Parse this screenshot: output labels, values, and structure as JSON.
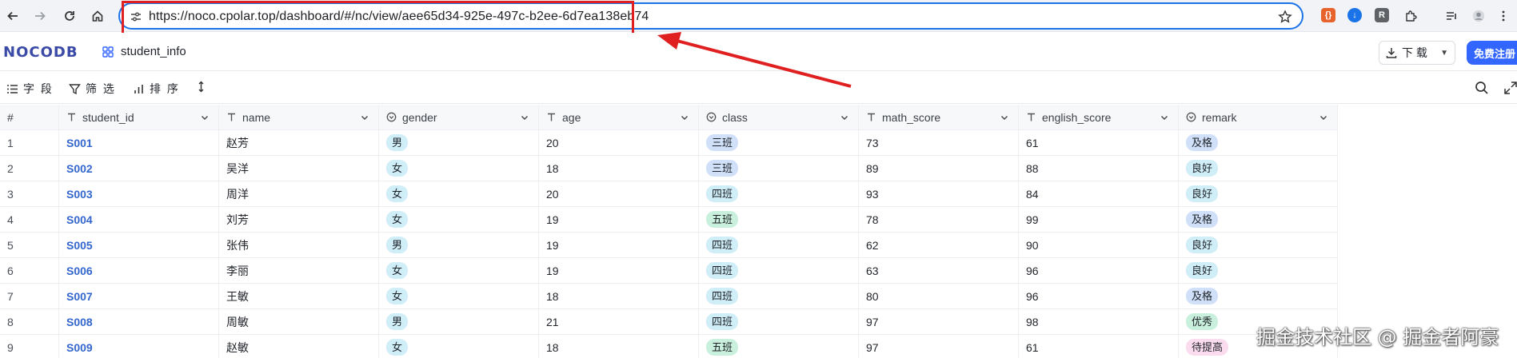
{
  "browser": {
    "url": "https://noco.cpolar.top/dashboard/#/nc/view/aee65d34-925e-497c-b2ee-6d7ea138eb74"
  },
  "app": {
    "logo": "NOCODB",
    "table_title": "student_info",
    "download_label": "下 载",
    "signup_label": "免费注册"
  },
  "toolbar": {
    "fields_label": "字 段",
    "filter_label": "筛 选",
    "sort_label": "排 序"
  },
  "grid": {
    "columns": [
      {
        "label": "#",
        "icon": "none"
      },
      {
        "label": "student_id",
        "icon": "text-icon"
      },
      {
        "label": "name",
        "icon": "text-icon"
      },
      {
        "label": "gender",
        "icon": "select-icon"
      },
      {
        "label": "age",
        "icon": "text-icon"
      },
      {
        "label": "class",
        "icon": "select-icon"
      },
      {
        "label": "math_score",
        "icon": "text-icon"
      },
      {
        "label": "english_score",
        "icon": "text-icon"
      },
      {
        "label": "remark",
        "icon": "select-icon"
      }
    ],
    "rows": [
      {
        "n": "1",
        "student_id": "S001",
        "name": "赵芳",
        "gender": "男",
        "age": "20",
        "class": "三班",
        "math_score": "73",
        "english_score": "61",
        "remark": "及格"
      },
      {
        "n": "2",
        "student_id": "S002",
        "name": "吴洋",
        "gender": "女",
        "age": "18",
        "class": "三班",
        "math_score": "89",
        "english_score": "88",
        "remark": "良好"
      },
      {
        "n": "3",
        "student_id": "S003",
        "name": "周洋",
        "gender": "女",
        "age": "20",
        "class": "四班",
        "math_score": "93",
        "english_score": "84",
        "remark": "良好"
      },
      {
        "n": "4",
        "student_id": "S004",
        "name": "刘芳",
        "gender": "女",
        "age": "19",
        "class": "五班",
        "math_score": "78",
        "english_score": "99",
        "remark": "及格"
      },
      {
        "n": "5",
        "student_id": "S005",
        "name": "张伟",
        "gender": "男",
        "age": "19",
        "class": "四班",
        "math_score": "62",
        "english_score": "90",
        "remark": "良好"
      },
      {
        "n": "6",
        "student_id": "S006",
        "name": "李丽",
        "gender": "女",
        "age": "19",
        "class": "四班",
        "math_score": "63",
        "english_score": "96",
        "remark": "良好"
      },
      {
        "n": "7",
        "student_id": "S007",
        "name": "王敏",
        "gender": "女",
        "age": "18",
        "class": "四班",
        "math_score": "80",
        "english_score": "96",
        "remark": "及格"
      },
      {
        "n": "8",
        "student_id": "S008",
        "name": "周敏",
        "gender": "男",
        "age": "21",
        "class": "四班",
        "math_score": "97",
        "english_score": "98",
        "remark": "优秀"
      },
      {
        "n": "9",
        "student_id": "S009",
        "name": "赵敏",
        "gender": "女",
        "age": "18",
        "class": "五班",
        "math_score": "97",
        "english_score": "61",
        "remark": "待提高"
      }
    ],
    "pill_colors": {
      "男": "#cfeef8",
      "女": "#cfeef8",
      "三班": "#cfe0f8",
      "四班": "#cfeef8",
      "五班": "#c9f0dc",
      "及格": "#cfe0f8",
      "良好": "#cfeef8",
      "优秀": "#c9f0dc",
      "待提高": "#fbdcef"
    }
  },
  "watermark": "掘金技术社区 @ 掘金者阿豪",
  "colors": {
    "accent": "#1a73e8",
    "annotation_red": "#e02020",
    "brand": "#3366ff"
  }
}
